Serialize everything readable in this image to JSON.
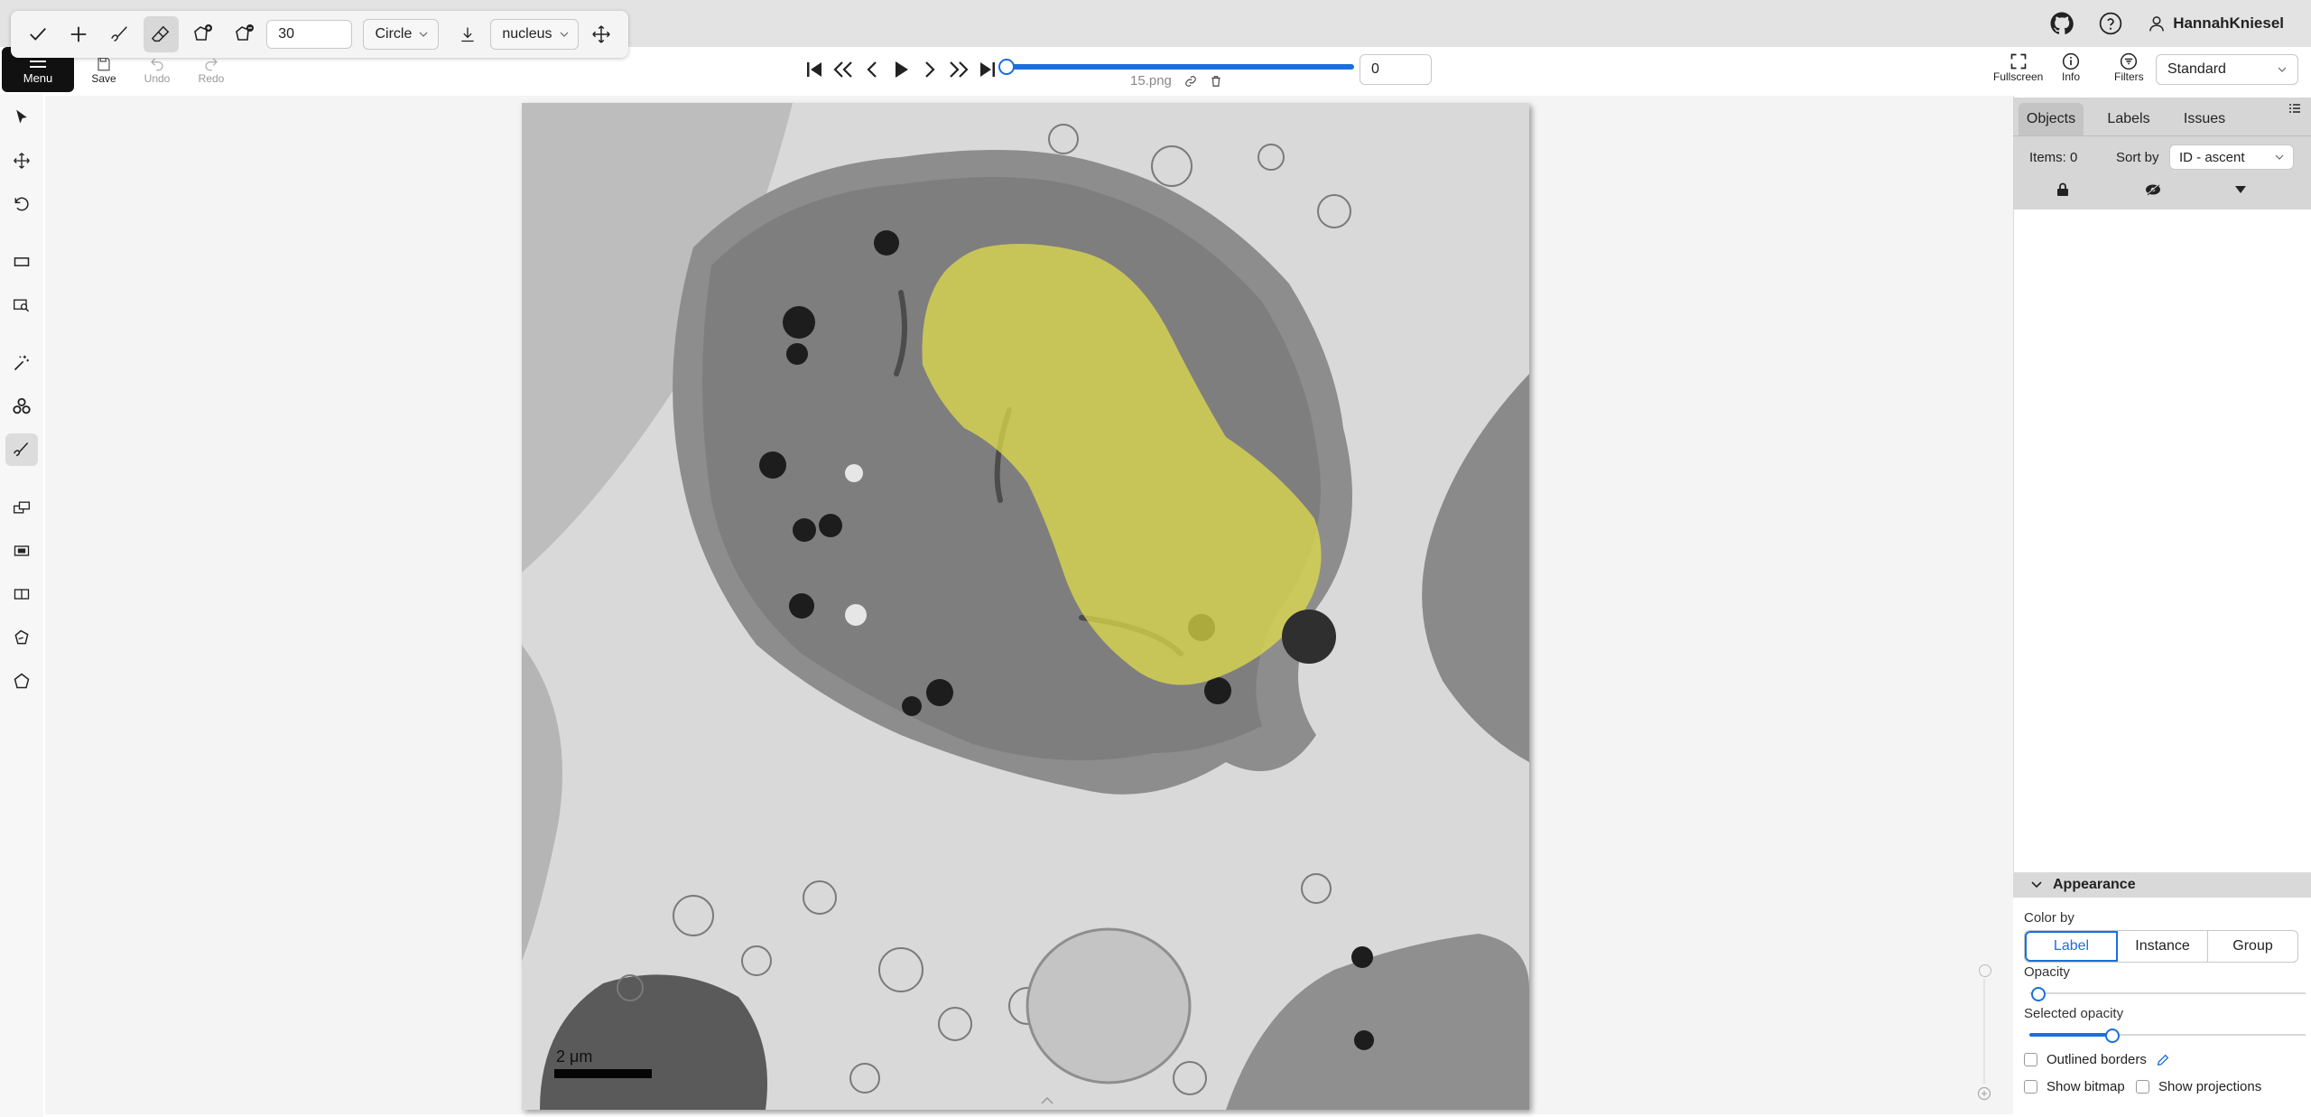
{
  "brush_toolbar": {
    "brush_size": "30",
    "brush_shape": "Circle",
    "label_select": "nucleus"
  },
  "actions": {
    "menu_label": "Menu",
    "save_label": "Save",
    "undo_label": "Undo",
    "redo_label": "Redo"
  },
  "navigation": {
    "frame_value": "0",
    "progress": 1.0,
    "filename": "15.png"
  },
  "header_right": {
    "username": "HannahKniesel",
    "fullscreen_label": "Fullscreen",
    "info_label": "Info",
    "filters_label": "Filters",
    "workspace_select": "Standard"
  },
  "image": {
    "scale_bar_text": "2 μm",
    "mask_color": "#e3e04a"
  },
  "side_panel": {
    "tabs": [
      "Objects",
      "Labels",
      "Issues"
    ],
    "active_tab": "Objects",
    "items_count": "Items: 0",
    "sort_by_label": "Sort by",
    "sort_by_value": "ID - ascent",
    "appearance": {
      "title": "Appearance",
      "color_by_label": "Color by",
      "color_by_options": [
        "Label",
        "Instance",
        "Group"
      ],
      "color_by_selected": "Label",
      "opacity_label": "Opacity",
      "opacity_value": 0.0,
      "selected_opacity_label": "Selected opacity",
      "selected_opacity_value": 0.3,
      "outlined_borders_label": "Outlined borders",
      "show_bitmap_label": "Show bitmap",
      "show_projections_label": "Show projections"
    }
  },
  "colors": {
    "accent": "#1a6fdb",
    "menu_bg": "#111111"
  }
}
